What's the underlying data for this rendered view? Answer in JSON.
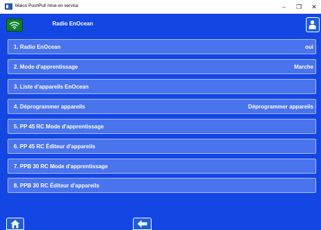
{
  "window": {
    "title": "Maico PushPull mise en service",
    "minimize_glyph": "–",
    "maximize_glyph": "❐",
    "close_glyph": "✕"
  },
  "header": {
    "title": "Radio EnOcean",
    "left_icon": "wifi-signal-icon",
    "right_icon": "user-icon"
  },
  "menu": {
    "items": [
      {
        "label": "1. Radio EnOcean",
        "value": "oui"
      },
      {
        "label": "2. Mode d'apprentissage",
        "value": "Marche"
      },
      {
        "label": "3. Liste d'appareils EnOcean",
        "value": ""
      },
      {
        "label": "4. Déprogrammer appareils",
        "value": "Déprogrammer appareils"
      },
      {
        "label": "5. PP 45 RC Mode d'apprentissage",
        "value": ""
      },
      {
        "label": "6. PP 45 RC Éditeur d'appareils",
        "value": ""
      },
      {
        "label": "7. PPB 30 RC Mode d'apprentissage",
        "value": ""
      },
      {
        "label": "8. PPB 30 RC Éditeur d'appareils",
        "value": ""
      }
    ]
  },
  "footer": {
    "home_icon": "home-icon",
    "back_icon": "back-arrow-icon"
  },
  "colors": {
    "background": "#1446e4",
    "item": "#4a74ee",
    "item_border": "#a9bdf7",
    "wifi_button": "#0d7e2e"
  }
}
